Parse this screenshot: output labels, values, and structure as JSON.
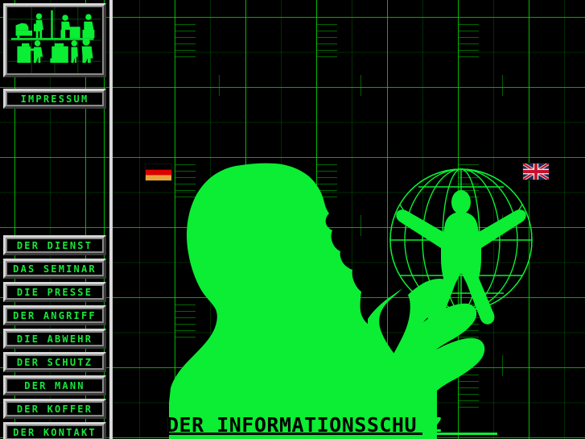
{
  "page": {
    "title": "DER INFORMATIONSSCHUTZ",
    "background_color": "#000000",
    "accent_color": "#0bee33",
    "grid_color": "#00aa00"
  },
  "sidebar": {
    "logo": {
      "name": "office-surveillance-silhouette-logo",
      "alt": "Silhouettes of people in an office"
    },
    "impressum": {
      "label": "IMPRESSUM"
    },
    "nav_items": [
      {
        "label": "DER DIENST"
      },
      {
        "label": "DAS SEMINAR"
      },
      {
        "label": "DIE PRESSE"
      },
      {
        "label": "DER ANGRIFF"
      },
      {
        "label": "DIE ABWEHR"
      },
      {
        "label": "DER SCHUTZ"
      },
      {
        "label": "DER MANN"
      },
      {
        "label": "DER KOFFER"
      },
      {
        "label": "DER KONTAKT"
      }
    ]
  },
  "flags": {
    "german": {
      "name": "german-flag",
      "label": "Deutsch"
    },
    "uk": {
      "name": "uk-flag",
      "label": "English"
    }
  },
  "artwork": {
    "head": "head-silhouette",
    "hand": "hand-silhouette",
    "globe": "wireframe-globe",
    "figure": "vitruvian-figure"
  }
}
